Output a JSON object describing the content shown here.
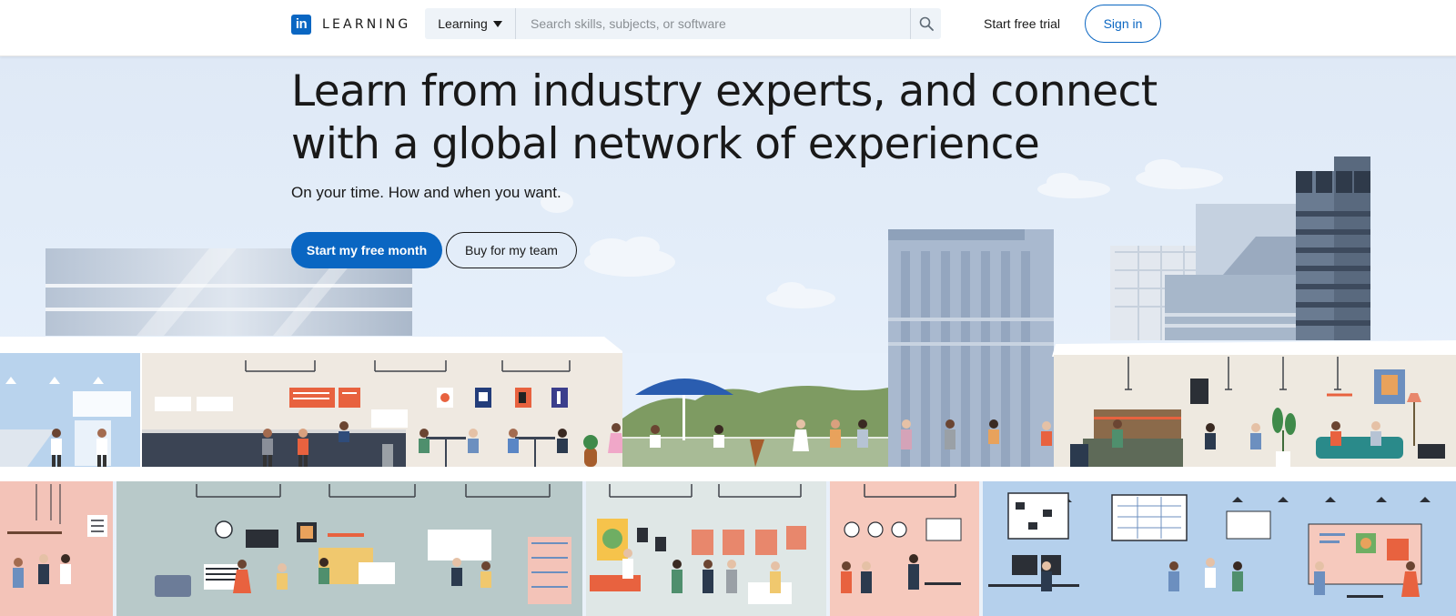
{
  "header": {
    "logo_letters": "in",
    "logo_word": "LEARNING",
    "search_category": "Learning",
    "search_placeholder": "Search skills, subjects, or software",
    "start_trial": "Start free trial",
    "sign_in": "Sign in"
  },
  "hero": {
    "headline": "Learn from industry experts, and connect with a global network of experience",
    "subheadline": "On your time. How and when you want.",
    "primary_cta": "Start my free month",
    "secondary_cta": "Buy for my team"
  },
  "colors": {
    "brand_blue": "#0a66c2",
    "sky": "#e3edf9",
    "text": "#191919"
  },
  "icons": [
    "linkedin-logo-icon",
    "caret-down-icon",
    "search-icon"
  ]
}
